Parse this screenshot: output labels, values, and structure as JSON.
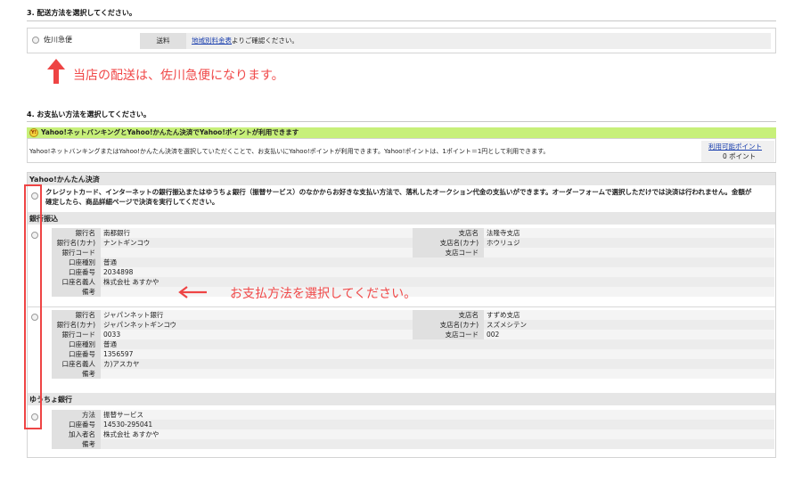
{
  "shipping": {
    "section_title": "3. 配送方法を選択してください。",
    "option_label": "佐川急便",
    "fee_label": "送料",
    "fee_link": "地域別料金表",
    "fee_suffix": "よりご確認ください。",
    "annotation": "当店の配送は、佐川急便になります。"
  },
  "payment": {
    "section_title": "4. お支払い方法を選択してください。",
    "yahoo_banner": "Yahoo!ネットバンキングとYahoo!かんたん決済でYahoo!ポイントが利用できます",
    "yahoo_banner_icon": "Y!",
    "yahoo_desc": "Yahoo!ネットバンキングまたはYahoo!かんたん決済を選択していただくことで、お支払いにYahoo!ポイントが利用できます。Yahoo!ポイントは、1ポイント＝1円として利用できます。",
    "points_link": "利用可能ポイント",
    "points_value": "0 ポイント",
    "kantan_title": "Yahoo!かんたん決済",
    "kantan_desc_line1": "クレジットカード、インターネットの銀行振込またはゆうちょ銀行（振替サービス）のなかからお好きな支払い方法で、落札したオークション代金の支払いができます。オーダーフォームで選択しただけでは決済は行われません。金額が",
    "kantan_desc_line2": "確定したら、商品詳細ページで決済を実行してください。",
    "bank_title": "銀行振込",
    "annotation": "お支払方法を選択してください。",
    "banks": [
      {
        "rows": [
          {
            "l": "銀行名",
            "v": "南都銀行",
            "l2": "支店名",
            "v2": "法隆寺支店"
          },
          {
            "l": "銀行名(カナ)",
            "v": "ナントギンコウ",
            "l2": "支店名(カナ)",
            "v2": "ホウリュジ"
          },
          {
            "l": "銀行コード",
            "v": "",
            "l2": "支店コード",
            "v2": ""
          },
          {
            "l": "口座種別",
            "v": "普通",
            "l2": "",
            "v2": ""
          },
          {
            "l": "口座番号",
            "v": "2034898",
            "l2": "",
            "v2": ""
          },
          {
            "l": "口座名義人",
            "v": "株式会社 あすかや",
            "l2": "",
            "v2": ""
          },
          {
            "l": "備考",
            "v": "",
            "l2": "",
            "v2": ""
          }
        ]
      },
      {
        "rows": [
          {
            "l": "銀行名",
            "v": "ジャパンネット銀行",
            "l2": "支店名",
            "v2": "すずめ支店"
          },
          {
            "l": "銀行名(カナ)",
            "v": "ジャパンネットギンコウ",
            "l2": "支店名(カナ)",
            "v2": "スズメシテン"
          },
          {
            "l": "銀行コード",
            "v": "0033",
            "l2": "支店コード",
            "v2": "002"
          },
          {
            "l": "口座種別",
            "v": "普通",
            "l2": "",
            "v2": ""
          },
          {
            "l": "口座番号",
            "v": "1356597",
            "l2": "",
            "v2": ""
          },
          {
            "l": "口座名義人",
            "v": "カ)アスカヤ",
            "l2": "",
            "v2": ""
          },
          {
            "l": "備考",
            "v": "",
            "l2": "",
            "v2": ""
          }
        ]
      }
    ],
    "yucho_title": "ゆうちょ銀行",
    "yucho_rows": [
      {
        "l": "方法",
        "v": "振替サービス"
      },
      {
        "l": "口座番号",
        "v": "14530-295041"
      },
      {
        "l": "加入者名",
        "v": "株式会社 あすかや"
      },
      {
        "l": "備考",
        "v": ""
      }
    ]
  },
  "colors": {
    "accent_red": "#ee4444",
    "yahoo_green": "#c7f07a",
    "link_blue": "#1a3fae"
  }
}
